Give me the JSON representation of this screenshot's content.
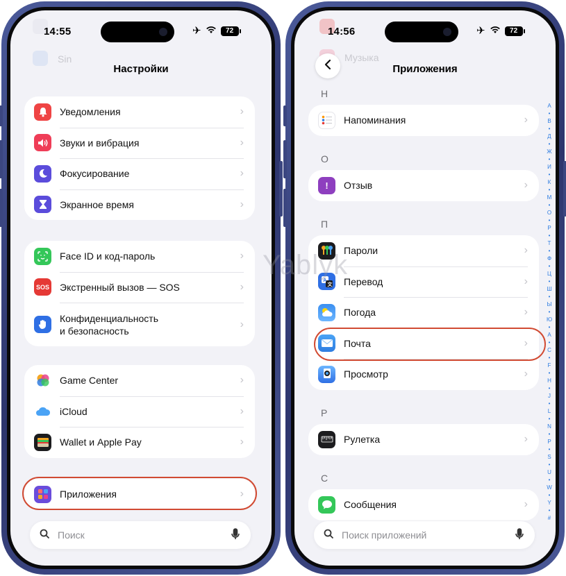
{
  "left_phone": {
    "status": {
      "time": "14:55",
      "battery": "72"
    },
    "ghost_label": "Sin",
    "nav_title": "Настройки",
    "groups": [
      {
        "items": [
          {
            "label": "Уведомления",
            "icon": "bell-icon",
            "color": "#ef4444"
          },
          {
            "label": "Звуки и вибрация",
            "icon": "speaker-icon",
            "color": "#ef3d57"
          },
          {
            "label": "Фокусирование",
            "icon": "moon-icon",
            "color": "#5b4cdb"
          },
          {
            "label": "Экранное время",
            "icon": "hourglass-icon",
            "color": "#5b4cdb"
          }
        ]
      },
      {
        "items": [
          {
            "label": "Face ID и код-пароль",
            "icon": "faceid-icon",
            "color": "#34c759"
          },
          {
            "label": "Экстренный вызов — SOS",
            "icon": "sos-icon",
            "color": "#e53935",
            "text": "SOS"
          },
          {
            "label": "Конфиденциальность\nи безопасность",
            "icon": "hand-icon",
            "color": "#2f6fe4"
          }
        ]
      },
      {
        "items": [
          {
            "label": "Game Center",
            "icon": "game-center-icon",
            "color": "#ffffff"
          },
          {
            "label": "iCloud",
            "icon": "cloud-icon",
            "color": "#ffffff"
          },
          {
            "label": "Wallet и Apple Pay",
            "icon": "wallet-icon",
            "color": "#1c1c1e"
          }
        ]
      },
      {
        "items": [
          {
            "label": "Приложения",
            "icon": "apps-grid-icon",
            "color": "#6a4cdb"
          }
        ]
      }
    ],
    "search_placeholder": "Поиск"
  },
  "right_phone": {
    "status": {
      "time": "14:56",
      "battery": "72"
    },
    "ghost_labels": [
      "Музыка"
    ],
    "nav_title": "Приложения",
    "sections": [
      {
        "letter": "Н",
        "items": [
          {
            "label": "Напоминания",
            "icon": "reminders-icon",
            "color": "#ffffff"
          }
        ]
      },
      {
        "letter": "О",
        "items": [
          {
            "label": "Отзыв",
            "icon": "feedback-icon",
            "color": "#8e3fbf",
            "text": "!"
          }
        ]
      },
      {
        "letter": "П",
        "items": [
          {
            "label": "Пароли",
            "icon": "key-icon",
            "color": "#1c1c1e"
          },
          {
            "label": "Перевод",
            "icon": "translate-icon",
            "color": "#2f6fe4"
          },
          {
            "label": "Погода",
            "icon": "weather-icon",
            "color": "#3b8ff0"
          },
          {
            "label": "Почта",
            "icon": "mail-icon",
            "color": "#4aa3f5"
          },
          {
            "label": "Просмотр",
            "icon": "preview-icon",
            "color": "#3b8ff0"
          }
        ]
      },
      {
        "letter": "Р",
        "items": [
          {
            "label": "Рулетка",
            "icon": "ruler-icon",
            "color": "#1c1c1e"
          }
        ]
      },
      {
        "letter": "С",
        "items": [
          {
            "label": "Сообщения",
            "icon": "messages-icon",
            "color": "#34c759"
          }
        ]
      }
    ],
    "search_placeholder": "Поиск приложений",
    "index_letters": [
      "А",
      "•",
      "В",
      "•",
      "Д",
      "•",
      "Ж",
      "•",
      "И",
      "•",
      "К",
      "•",
      "М",
      "•",
      "О",
      "•",
      "Р",
      "•",
      "Т",
      "•",
      "Ф",
      "•",
      "Ц",
      "•",
      "Ш",
      "•",
      "Ы",
      "•",
      "Ю",
      "•",
      "A",
      "•",
      "C",
      "•",
      "F",
      "•",
      "H",
      "•",
      "J",
      "•",
      "L",
      "•",
      "N",
      "•",
      "P",
      "•",
      "S",
      "•",
      "U",
      "•",
      "W",
      "•",
      "Y",
      "•",
      "#"
    ]
  },
  "watermark": "Yablyk",
  "colors": {
    "highlight": "#d14a32",
    "accent": "#2f7de1"
  }
}
